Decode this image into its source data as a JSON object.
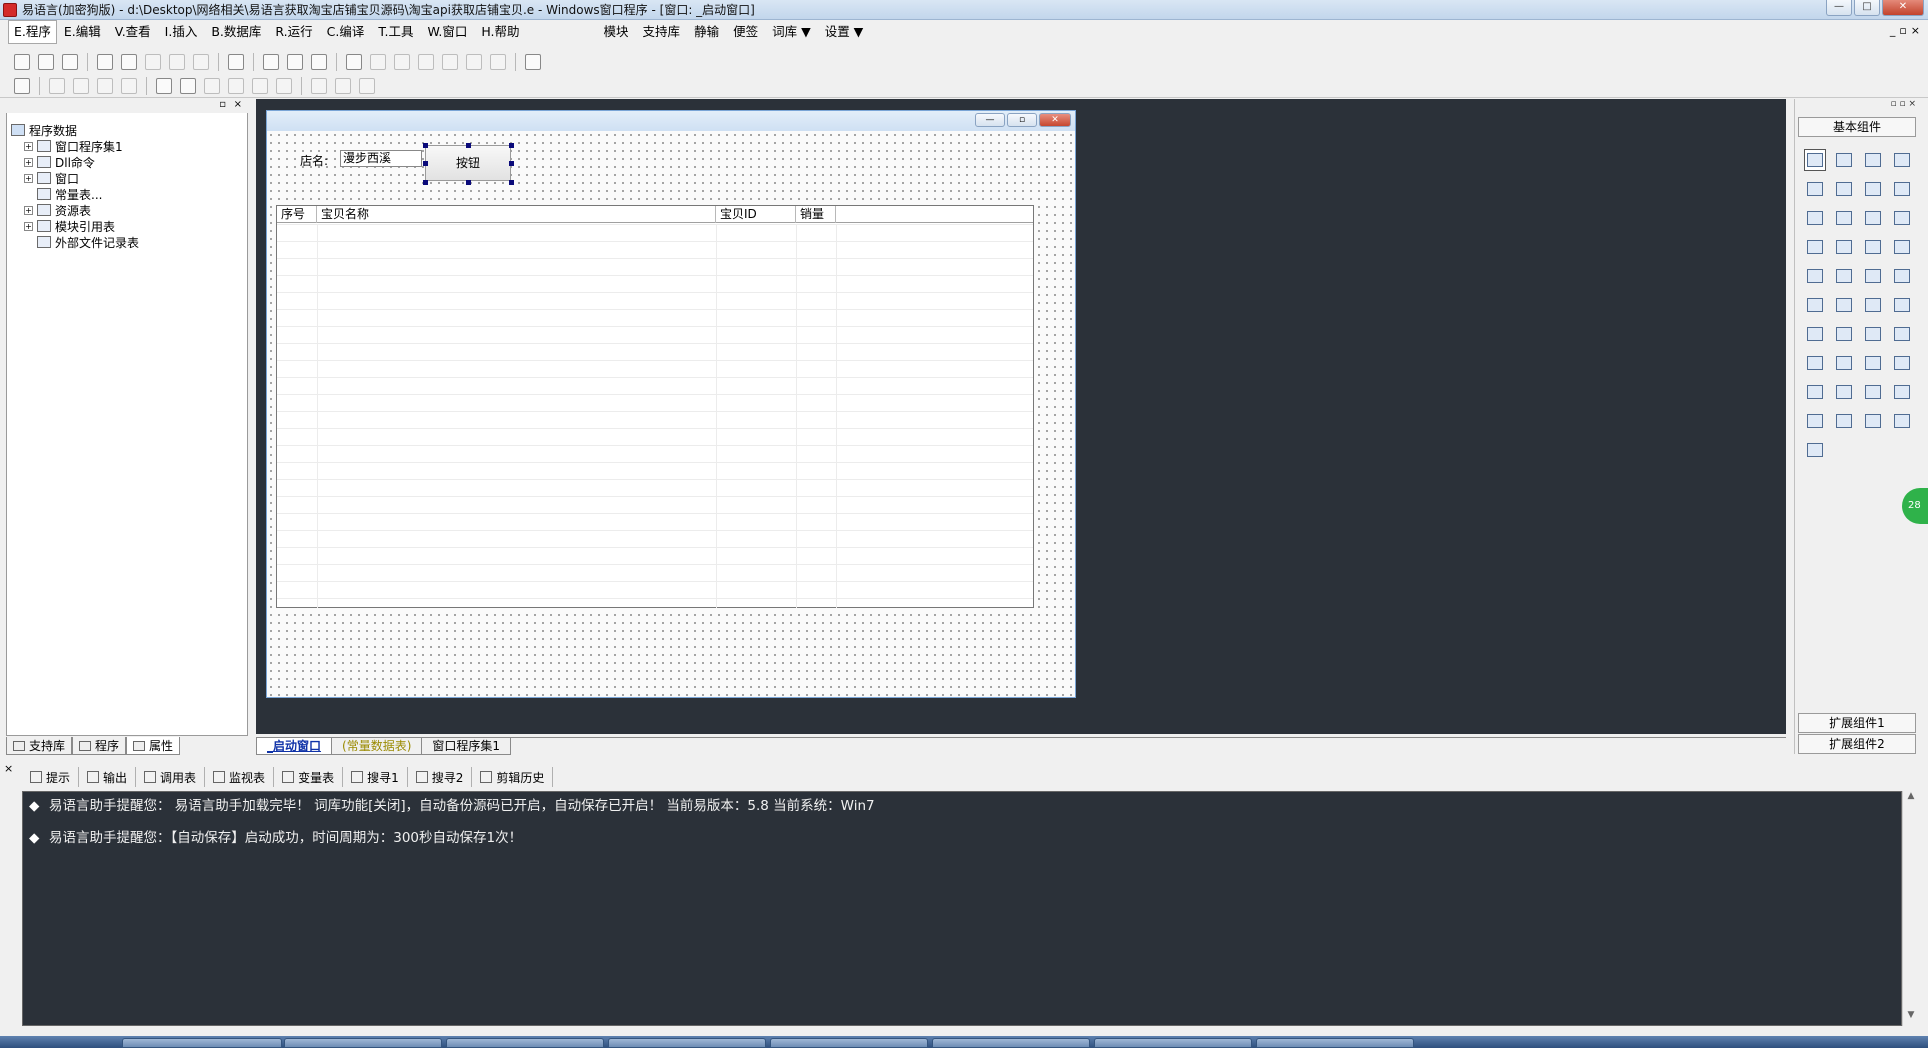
{
  "window": {
    "title": "易语言(加密狗版) - d:\\Desktop\\网络相关\\易语言获取淘宝店铺宝贝源码\\淘宝api获取店铺宝贝.e - Windows窗口程序 - [窗口: _启动窗口]",
    "controls": {
      "minimize": "—",
      "restore": "□",
      "close": "✕"
    }
  },
  "menubar": {
    "items": [
      "E.程序",
      "E.编辑",
      "V.查看",
      "I.插入",
      "B.数据库",
      "R.运行",
      "C.编译",
      "T.工具",
      "W.窗口",
      "H.帮助"
    ],
    "extra": [
      "模块",
      "支持库",
      "静输",
      "便签",
      "词库 ▼",
      "设置 ▼"
    ],
    "mdi": [
      "_",
      "▫",
      "×"
    ]
  },
  "left_panel": {
    "pin": "▫",
    "close": "×",
    "tree": {
      "root": "程序数据",
      "children": [
        {
          "label": "窗口程序集1",
          "expand": "+"
        },
        {
          "label": "Dll命令",
          "expand": "+"
        },
        {
          "label": "窗口",
          "expand": "+"
        },
        {
          "label": "常量表...",
          "expand": ""
        },
        {
          "label": "资源表",
          "expand": "+"
        },
        {
          "label": "模块引用表",
          "expand": "+"
        },
        {
          "label": "外部文件记录表",
          "expand": ""
        }
      ]
    },
    "tabs": [
      "支持库",
      "程序",
      "属性"
    ]
  },
  "form": {
    "controls": {
      "minimize": "—",
      "restore": "▫",
      "close": "✕"
    },
    "shop_label": "店名:",
    "shop_input_value": "漫步西溪",
    "button_label": "按钮",
    "grid": {
      "columns": [
        "序号",
        "宝贝名称",
        "宝贝ID",
        "销量"
      ]
    }
  },
  "doc_tabs": [
    "_启动窗口",
    "(常量数据表)",
    "窗口程序集1"
  ],
  "toolbox": {
    "header": "▫ ▫ ×",
    "basic": "基本组件",
    "ext1": "扩展组件1",
    "ext2": "扩展组件2"
  },
  "badge": "28",
  "bottom": {
    "close": "×",
    "tabs": [
      "提示",
      "输出",
      "调用表",
      "监视表",
      "变量表",
      "搜寻1",
      "搜寻2",
      "剪辑历史"
    ],
    "lines": [
      "易语言助手提醒您：  易语言助手加载完毕！  词库功能[关闭]，自动备份源码已开启，自动保存已开启！  当前易版本：5.8  当前系统：Win7",
      "易语言助手提醒您：【自动保存】启动成功，时间周期为：300秒自动保存1次！"
    ],
    "bullet": "◆",
    "scroll_up": "▲",
    "scroll_down": "▼"
  }
}
